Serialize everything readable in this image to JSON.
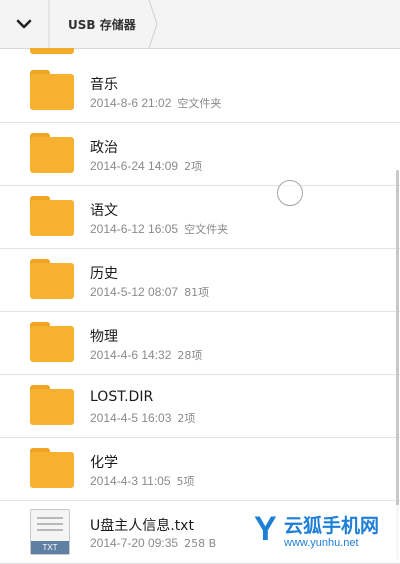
{
  "header": {
    "breadcrumb_label": "USB 存储器"
  },
  "files": [
    {
      "name": "音乐",
      "date": "2014-8-6 21:02",
      "info": "空文件夹",
      "type": "folder"
    },
    {
      "name": "政治",
      "date": "2014-6-24 14:09",
      "info": "2项",
      "type": "folder"
    },
    {
      "name": "语文",
      "date": "2014-6-12 16:05",
      "info": "空文件夹",
      "type": "folder"
    },
    {
      "name": "历史",
      "date": "2014-5-12 08:07",
      "info": "81项",
      "type": "folder"
    },
    {
      "name": "物理",
      "date": "2014-4-6 14:32",
      "info": "28项",
      "type": "folder"
    },
    {
      "name": "LOST.DIR",
      "date": "2014-4-5 16:03",
      "info": "2项",
      "type": "folder"
    },
    {
      "name": "化学",
      "date": "2014-4-3 11:05",
      "info": "5项",
      "type": "folder"
    },
    {
      "name": "U盘主人信息.txt",
      "date": "2014-7-20 09:35",
      "info": "258 B",
      "type": "txt",
      "badge": "TXT"
    }
  ],
  "watermark": {
    "logo": "Y",
    "title": "云狐手机网",
    "url": "www.yunhu.net"
  },
  "icons": {
    "collapse": "chevron-down-icon",
    "folder": "folder-icon",
    "txt_file": "txt-file-icon"
  },
  "colors": {
    "folder": "#f6b130",
    "header_bg": "#f4f4f4",
    "txt_badge": "#5f7fa3",
    "watermark": "#1e7fd6"
  }
}
